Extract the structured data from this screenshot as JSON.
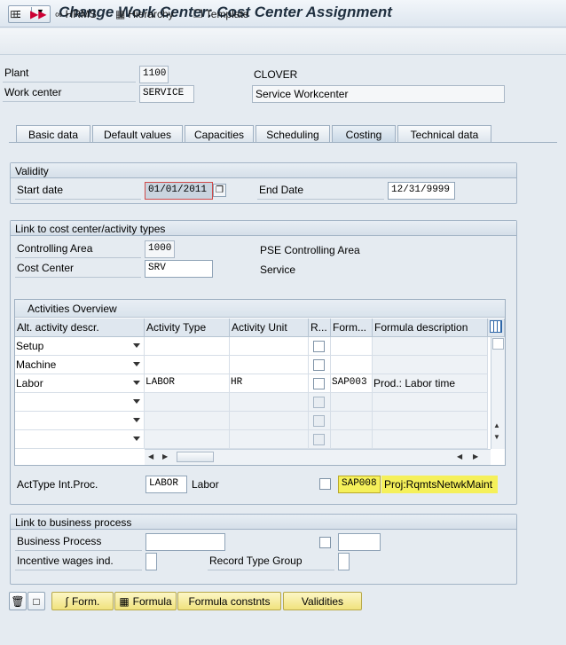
{
  "window": {
    "title": "Change Work Center: Cost Center Assignment"
  },
  "toolbar": {
    "hrms": "HRMS",
    "hierarchy": "Hierarchy",
    "template": "Template"
  },
  "header": {
    "plant_label": "Plant",
    "plant_value": "1100",
    "plant_desc": "CLOVER",
    "workcenter_label": "Work center",
    "workcenter_value": "SERVICE",
    "workcenter_desc": "Service Workcenter"
  },
  "tabs": [
    {
      "label": "Basic data"
    },
    {
      "label": "Default values"
    },
    {
      "label": "Capacities"
    },
    {
      "label": "Scheduling"
    },
    {
      "label": "Costing",
      "active": true
    },
    {
      "label": "Technical data"
    }
  ],
  "validity": {
    "title": "Validity",
    "start_label": "Start date",
    "start_value": "01/01/2011",
    "end_label": "End Date",
    "end_value": "12/31/9999"
  },
  "link_cc": {
    "title": "Link to cost center/activity types",
    "ca_label": "Controlling Area",
    "ca_value": "1000",
    "ca_desc": "PSE Controlling Area",
    "cc_label": "Cost Center",
    "cc_value": "SRV",
    "cc_desc": "Service"
  },
  "activities": {
    "title": "Activities Overview",
    "columns": [
      "Alt. activity descr.",
      "Activity Type",
      "Activity Unit",
      "R...",
      "Form...",
      "Formula description"
    ],
    "rows": [
      {
        "descr": "Setup",
        "type": "",
        "unit": "",
        "formula": "",
        "fdesc": ""
      },
      {
        "descr": "Machine",
        "type": "",
        "unit": "",
        "formula": "",
        "fdesc": ""
      },
      {
        "descr": "Labor",
        "type": "LABOR",
        "unit": "HR",
        "formula": "SAP003",
        "fdesc": "Prod.: Labor time"
      },
      {
        "descr": "",
        "type": "",
        "unit": "",
        "formula": "",
        "fdesc": ""
      },
      {
        "descr": "",
        "type": "",
        "unit": "",
        "formula": "",
        "fdesc": ""
      },
      {
        "descr": "",
        "type": "",
        "unit": "",
        "formula": "",
        "fdesc": ""
      }
    ]
  },
  "acttype_intproc": {
    "label": "ActType Int.Proc.",
    "value": "LABOR",
    "desc": "Labor",
    "formula": "SAP008",
    "formula_desc": "Proj:RqmtsNetwkMaint",
    "highlight_color": "#f5f05a"
  },
  "link_bp": {
    "title": "Link to business process",
    "bp_label": "Business Process",
    "bp_value": "",
    "incentive_label": "Incentive wages ind.",
    "rtg_label": "Record Type Group"
  },
  "buttons": {
    "form_label": "Form.",
    "formula_label": "Formula",
    "formula_constants_label": "Formula constnts",
    "validities_label": "Validities"
  },
  "colors": {
    "button_yellow": "#f6ec9a",
    "background": "#e5ebf1"
  }
}
